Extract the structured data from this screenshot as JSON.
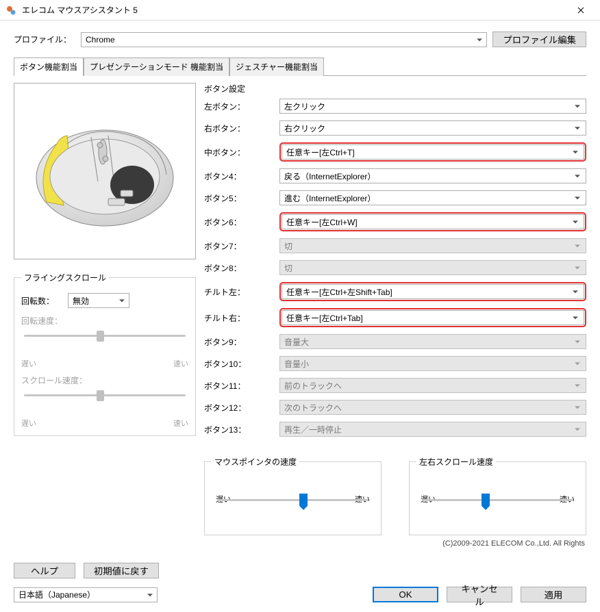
{
  "window": {
    "title": "エレコム マウスアシスタント 5"
  },
  "profile": {
    "label": "プロファイル：",
    "value": "Chrome",
    "edit_button": "プロファイル編集"
  },
  "tabs": {
    "0": "ボタン機能割当",
    "1": "プレゼンテーションモード 機能割当",
    "2": "ジェスチャー機能割当"
  },
  "flying_scroll": {
    "legend": "フライングスクロール",
    "rotation_label": "回転数：",
    "rotation_value": "無効",
    "rotation_speed_label": "回転速度：",
    "scroll_speed_label": "スクロール速度：",
    "slow": "遅い",
    "fast": "速い"
  },
  "button_settings": {
    "group_title": "ボタン設定",
    "rows": {
      "left": {
        "label": "左ボタン：",
        "value": "左クリック"
      },
      "right": {
        "label": "右ボタン：",
        "value": "右クリック"
      },
      "middle": {
        "label": "中ボタン：",
        "value": "任意キー[左Ctrl+T]"
      },
      "b4": {
        "label": "ボタン4：",
        "value": "戻る（InternetExplorer）"
      },
      "b5": {
        "label": "ボタン5：",
        "value": "進む（InternetExplorer）"
      },
      "b6": {
        "label": "ボタン6：",
        "value": "任意キー[左Ctrl+W]"
      },
      "b7": {
        "label": "ボタン7：",
        "value": "切"
      },
      "b8": {
        "label": "ボタン8：",
        "value": "切"
      },
      "tilt_l": {
        "label": "チルト左：",
        "value": "任意キー[左Ctrl+左Shift+Tab]"
      },
      "tilt_r": {
        "label": "チルト右：",
        "value": "任意キー[左Ctrl+Tab]"
      },
      "b9": {
        "label": "ボタン9：",
        "value": "音量大"
      },
      "b10": {
        "label": "ボタン10：",
        "value": "音量小"
      },
      "b11": {
        "label": "ボタン11：",
        "value": "前のトラックへ"
      },
      "b12": {
        "label": "ボタン12：",
        "value": "次のトラックへ"
      },
      "b13": {
        "label": "ボタン13：",
        "value": "再生／一時停止"
      }
    }
  },
  "pointer_speed": {
    "legend": "マウスポインタの速度",
    "slow": "遅い",
    "fast": "速い"
  },
  "hscroll_speed": {
    "legend": "左右スクロール速度",
    "slow": "遅い",
    "fast": "速い"
  },
  "copyright": "(C)2009-2021 ELECOM Co.,Ltd. All Rights",
  "footer": {
    "help": "ヘルプ",
    "reset": "初期値に戻す",
    "language": "日本語（Japanese）",
    "ok": "OK",
    "cancel": "キャンセル",
    "apply": "適用"
  }
}
